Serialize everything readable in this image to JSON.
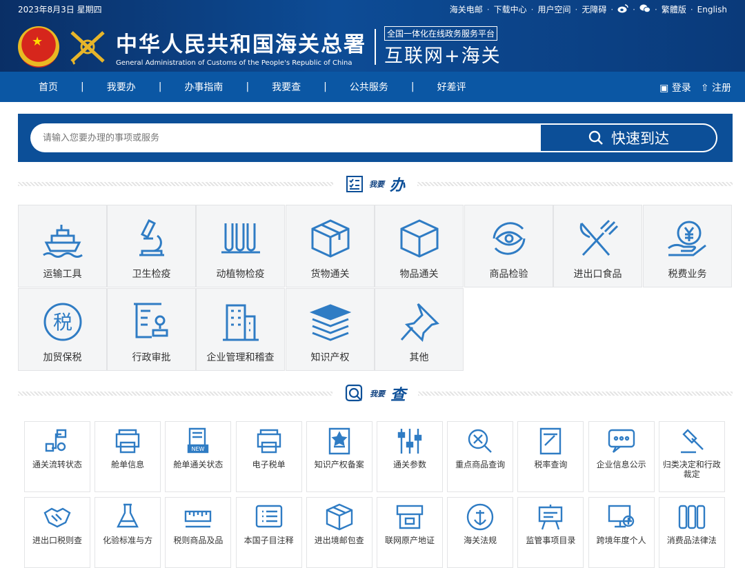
{
  "topbar": {
    "date": "2023年8月3日 星期四",
    "links": [
      "海关电邮",
      "下载中心",
      "用户空间",
      "无障碍",
      "繁體版",
      "English"
    ]
  },
  "header": {
    "title_cn": "中华人民共和国海关总署",
    "title_en": "General Administration of Customs of the People's Republic of China",
    "platform_small": "全国一体化在线政务服务平台",
    "platform_big": "互联网+海关"
  },
  "nav": {
    "items": [
      "首页",
      "我要办",
      "办事指南",
      "我要查",
      "公共服务",
      "好差评"
    ],
    "login": "登录",
    "register": "注册"
  },
  "search": {
    "placeholder": "请输入您要办理的事项或服务",
    "button": "快速到达"
  },
  "section_do": {
    "small": "我要",
    "big": "办",
    "tiles": [
      {
        "label": "运输工具",
        "icon": "ship-icon"
      },
      {
        "label": "卫生检疫",
        "icon": "microscope-icon"
      },
      {
        "label": "动植物检疫",
        "icon": "test-tubes-icon"
      },
      {
        "label": "货物通关",
        "icon": "box-icon"
      },
      {
        "label": "物品通关",
        "icon": "cube-icon"
      },
      {
        "label": "商品检验",
        "icon": "eye-icon"
      },
      {
        "label": "进出口食品",
        "icon": "fork-knife-icon"
      },
      {
        "label": "税费业务",
        "icon": "yuan-hand-icon"
      },
      {
        "label": "加贸保税",
        "icon": "tax-icon"
      },
      {
        "label": "行政审批",
        "icon": "approval-stamp-icon"
      },
      {
        "label": "企业管理和稽查",
        "icon": "building-icon"
      },
      {
        "label": "知识产权",
        "icon": "books-icon"
      },
      {
        "label": "其他",
        "icon": "pin-icon"
      }
    ]
  },
  "section_query": {
    "small": "我要",
    "big": "查",
    "cards": [
      {
        "label": "通关流转状态",
        "icon": "flow-icon"
      },
      {
        "label": "舱单信息",
        "icon": "printer-icon"
      },
      {
        "label": "舱单通关状态",
        "icon": "new-doc-icon"
      },
      {
        "label": "电子税单",
        "icon": "printer-icon"
      },
      {
        "label": "知识产权备案",
        "icon": "star-doc-icon"
      },
      {
        "label": "通关参数",
        "icon": "sliders-icon"
      },
      {
        "label": "重点商品查询",
        "icon": "search-x-icon"
      },
      {
        "label": "税率查询",
        "icon": "ticket-icon"
      },
      {
        "label": "企业信息公示",
        "icon": "chat-icon"
      },
      {
        "label": "归类决定和行政裁定",
        "icon": "gavel-icon"
      },
      {
        "label": "进出口税则查",
        "icon": "handshake-icon"
      },
      {
        "label": "化验标准与方",
        "icon": "flask-icon"
      },
      {
        "label": "税则商品及品",
        "icon": "ruler-icon"
      },
      {
        "label": "本国子目注释",
        "icon": "list-icon"
      },
      {
        "label": "进出境邮包查",
        "icon": "parcel-icon"
      },
      {
        "label": "联网原产地证",
        "icon": "cert-icon"
      },
      {
        "label": "海关法规",
        "icon": "anchor-icon"
      },
      {
        "label": "监管事项目录",
        "icon": "board-icon"
      },
      {
        "label": "跨境年度个人",
        "icon": "screen-icon"
      },
      {
        "label": "消费品法律法",
        "icon": "columns-icon"
      }
    ]
  },
  "colors": {
    "brand_blue": "#0c4f98",
    "nav_blue": "#0b57a4",
    "icon_blue": "#2f7cc4"
  }
}
